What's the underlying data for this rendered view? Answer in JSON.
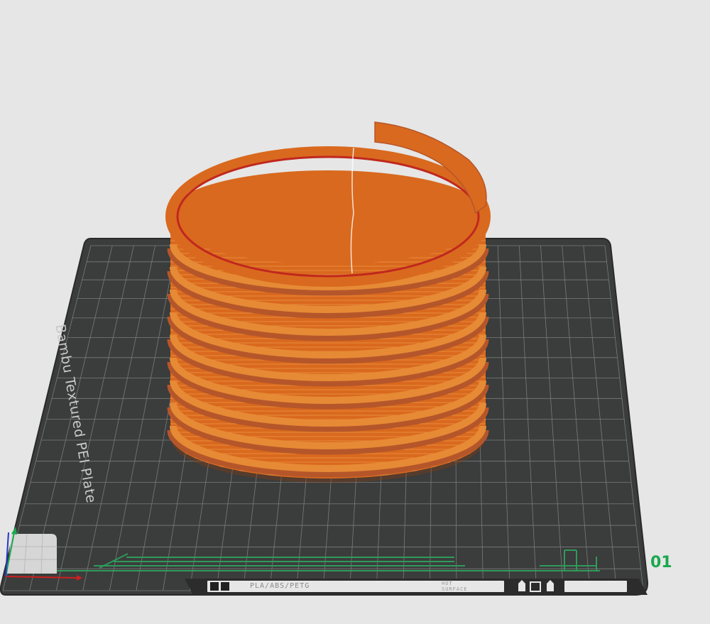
{
  "plate": {
    "name": "Bambu Textured PEI Plate",
    "number": "01",
    "filament_types": "PLA/ABS/PETG",
    "warning_line1": "HOT",
    "warning_line2": "SURFACE"
  },
  "model": {
    "color": "#d9691e",
    "edge_color": "#b5562a",
    "inner_color": "#c0281e"
  },
  "axes": {
    "x_color": "#cc1f1f",
    "y_color": "#1aa84e",
    "z_color": "#2a35c8"
  }
}
